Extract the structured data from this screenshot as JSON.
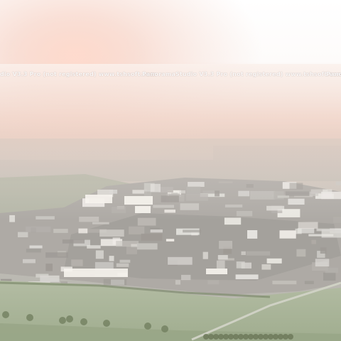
{
  "image": {
    "description_tag": "aerial-panorama",
    "watermark": {
      "text": "PanoramaStudio V3.3 Pro (not registered) www.tshsoft.com",
      "repeat_fragments": [
        "udio V3.3 Pro (not registered) www.tshsoft.com",
        "PanoramaStudio V3.3 Pro (not registered) www.tshsoft.com",
        "Pano"
      ]
    },
    "colors": {
      "sky": "#fdfbfa",
      "haze": "#f4d2c6",
      "town": "#b9b6b2",
      "fields": "#a9b49a"
    }
  }
}
